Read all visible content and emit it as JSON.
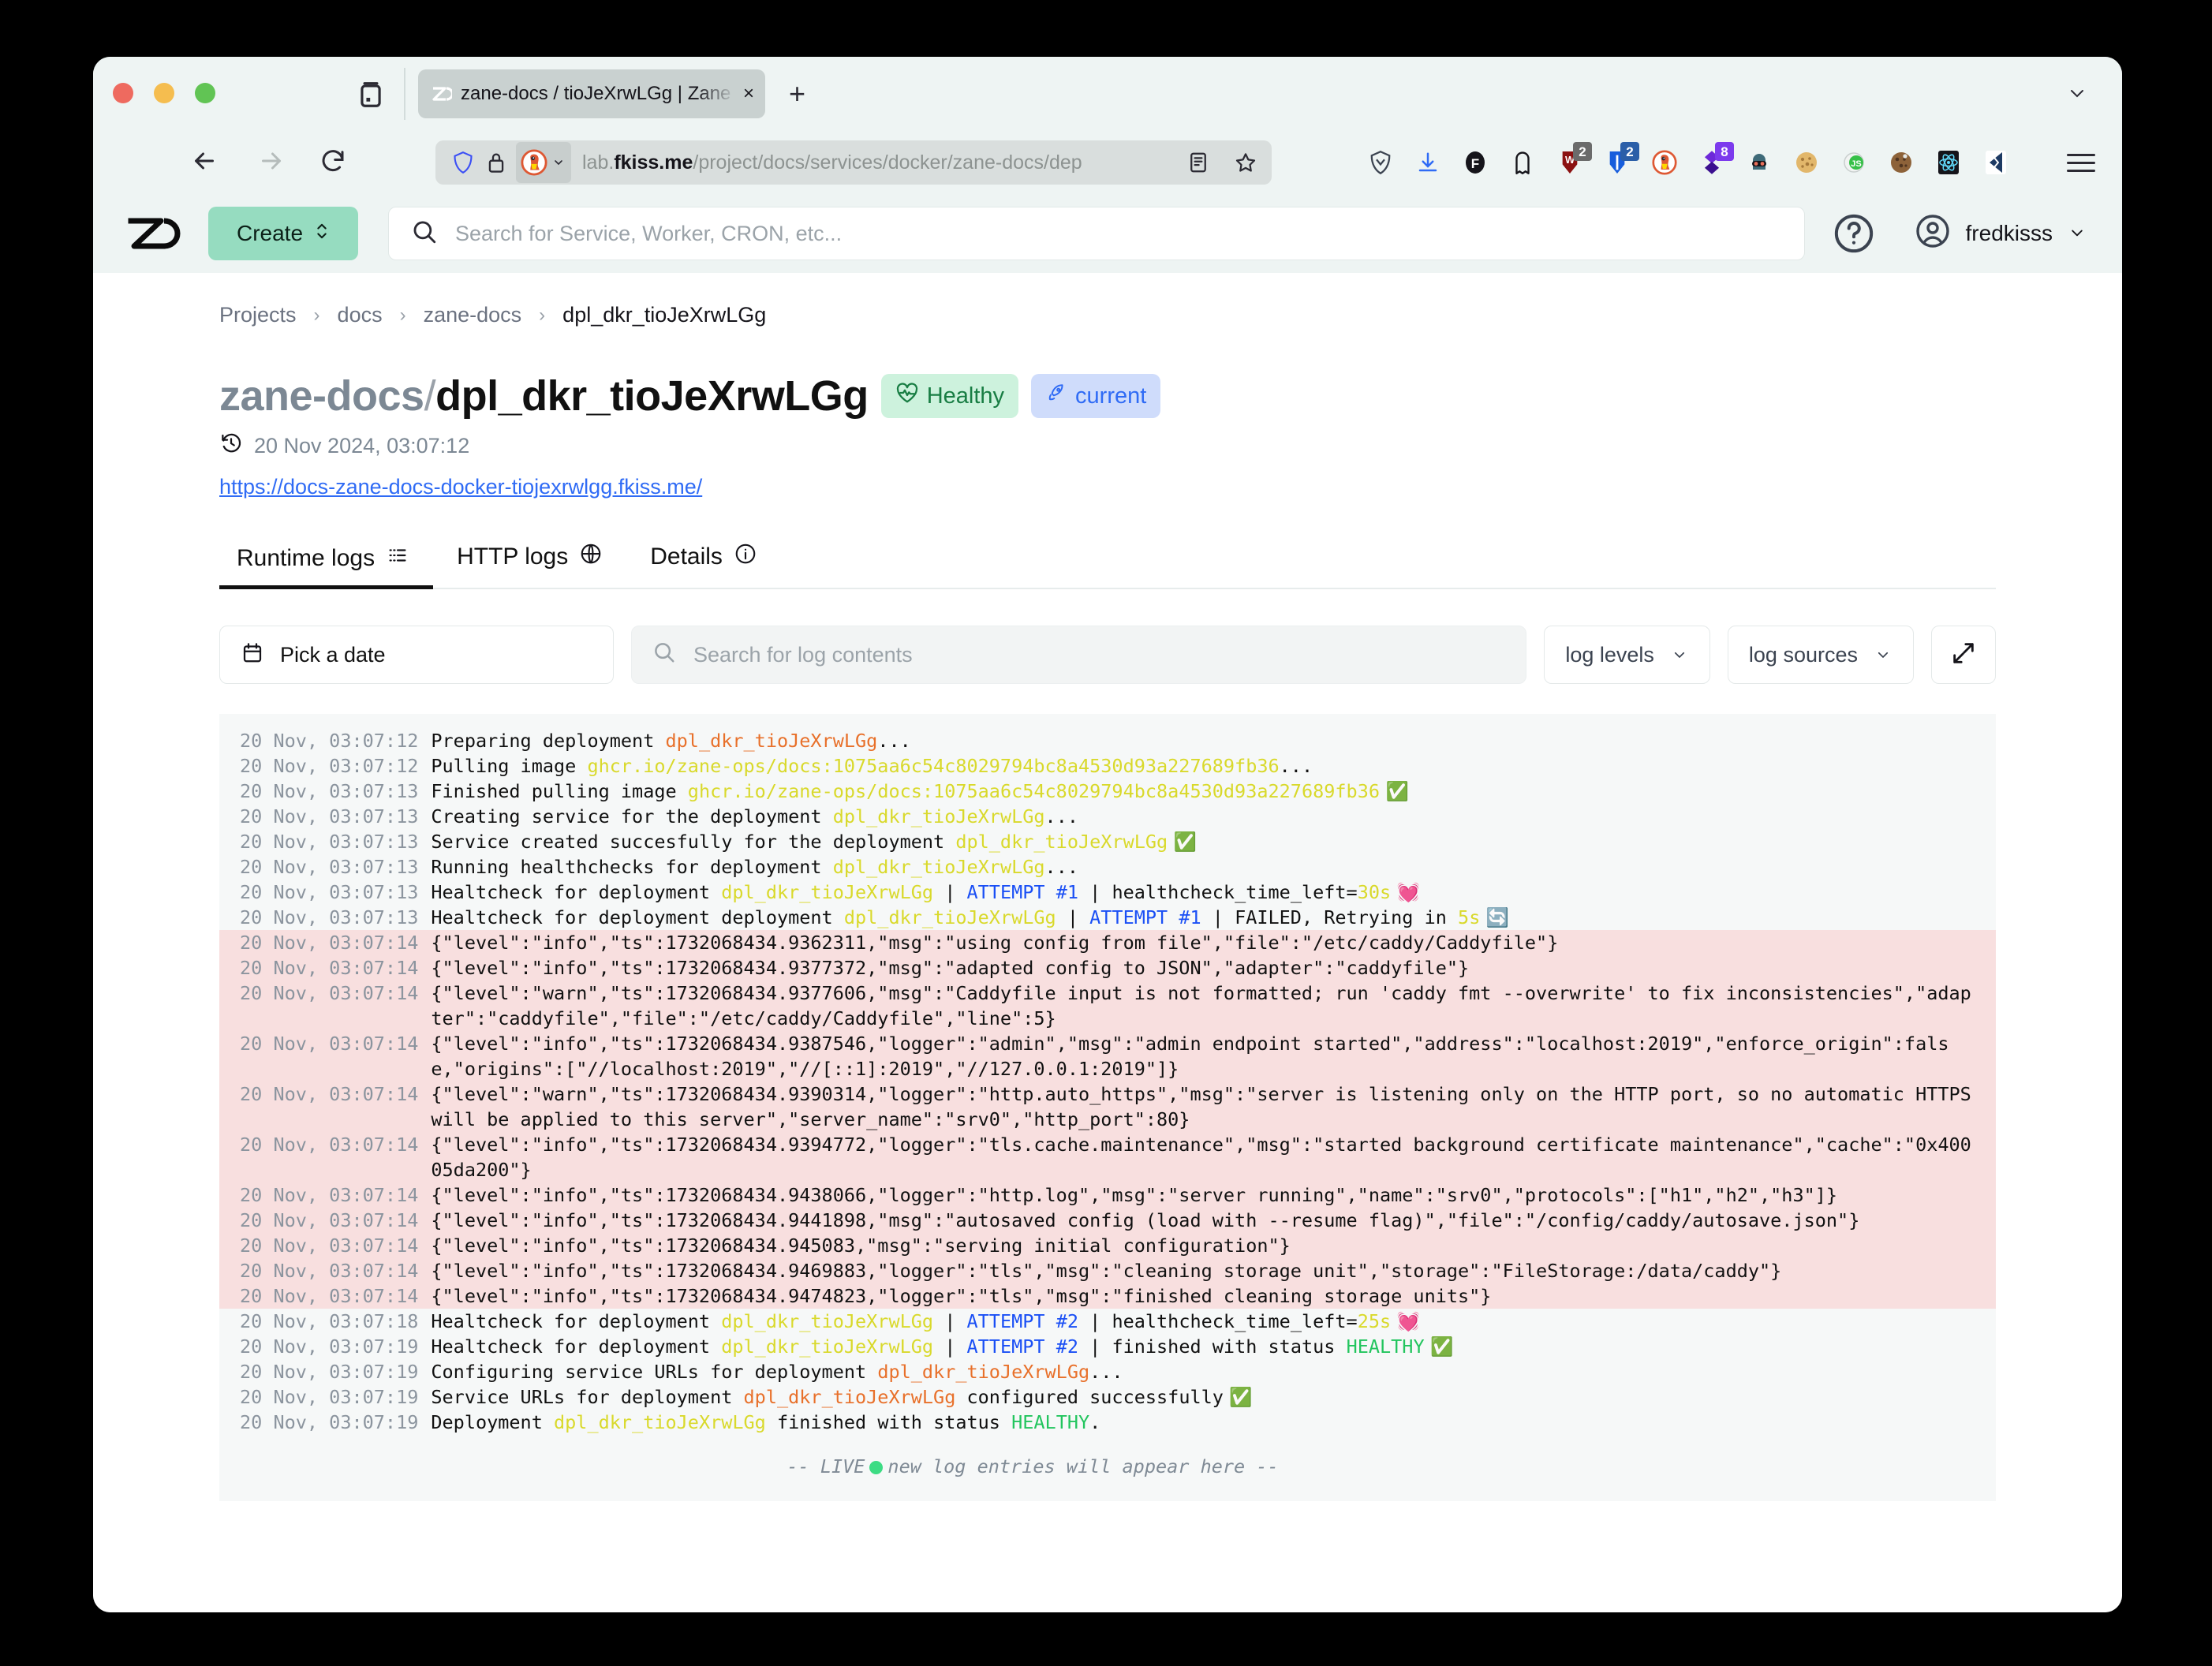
{
  "browser": {
    "tab": {
      "favicon": "zaneops-icon",
      "title": "zane-docs / tioJeXrwLGg | Zane",
      "close": "×"
    },
    "new_tab_label": "+",
    "url": {
      "host_dim_prefix": "lab.",
      "host_bold": "fkiss.me",
      "path": "/project/docs/services/docker/zane-docs/dep"
    },
    "extensions": [
      {
        "name": "nordvpn-icon",
        "badge": ""
      },
      {
        "name": "downloads-icon",
        "badge": ""
      },
      {
        "name": "facebook-container-icon",
        "badge": ""
      },
      {
        "name": "ghostery-icon",
        "badge": ""
      },
      {
        "name": "wappalyzer-icon",
        "badge": "2"
      },
      {
        "name": "bitwarden-icon",
        "badge": "2"
      },
      {
        "name": "duckduckgo-icon",
        "badge": ""
      },
      {
        "name": "react-devtools-purple-icon",
        "badge": "8"
      },
      {
        "name": "darkreader-icon",
        "badge": ""
      },
      {
        "name": "cookie-icon",
        "badge": ""
      },
      {
        "name": "json-viewer-icon",
        "badge": ""
      },
      {
        "name": "cookie-editor-icon",
        "badge": ""
      },
      {
        "name": "react-atom-icon",
        "badge": ""
      },
      {
        "name": "terminal-icon",
        "badge": ""
      }
    ]
  },
  "header": {
    "logo": "zaneops-logo",
    "create_label": "Create",
    "search_placeholder": "Search for Service, Worker, CRON, etc...",
    "search_value": "",
    "help_icon": "question-circle-icon",
    "user": "fredkisss"
  },
  "breadcrumb": [
    {
      "label": "Projects"
    },
    {
      "label": "docs"
    },
    {
      "label": "zane-docs"
    },
    {
      "label": "dpl_dkr_tioJeXrwLGg"
    }
  ],
  "breadcrumb_separator": "›",
  "page": {
    "service_name": "zane-docs",
    "separator": "/",
    "deployment_id": "dpl_dkr_tioJeXrwLGg",
    "status_badge": "Healthy",
    "current_badge": "current",
    "timestamp": "20 Nov 2024, 03:07:12",
    "deployment_url": "https://docs-zane-docs-docker-tiojexrwlgg.fkiss.me/"
  },
  "tabs": [
    {
      "label": "Runtime logs",
      "icon": "list-icon",
      "active": true
    },
    {
      "label": "HTTP logs",
      "icon": "globe-icon",
      "active": false
    },
    {
      "label": "Details",
      "icon": "info-circle-icon",
      "active": false
    }
  ],
  "toolbar": {
    "pick_date_label": "Pick a date",
    "pick_date_icon": "calendar-icon",
    "search_placeholder": "Search for log contents",
    "search_value": "",
    "log_levels_label": "log levels",
    "log_sources_label": "log sources",
    "expand_icon": "expand-icon"
  },
  "logs": {
    "live_prefix": "--",
    "live_label": "LIVE",
    "live_text": "new log entries will appear here",
    "live_suffix": "--",
    "lines": [
      {
        "ts": "20 Nov, 03:07:12",
        "err": false,
        "parts": [
          {
            "t": "Preparing deployment ",
            "c": ""
          },
          {
            "t": "dpl_dkr_tioJeXrwLGg",
            "c": "c-orange"
          },
          {
            "t": "...",
            "c": ""
          }
        ]
      },
      {
        "ts": "20 Nov, 03:07:12",
        "err": false,
        "parts": [
          {
            "t": "Pulling image ",
            "c": ""
          },
          {
            "t": "ghcr.io/zane-ops/docs:1075aa6c54c8029794bc8a4530d93a227689fb36",
            "c": "c-yellow"
          },
          {
            "t": "...",
            "c": ""
          }
        ]
      },
      {
        "ts": "20 Nov, 03:07:13",
        "err": false,
        "parts": [
          {
            "t": "Finished pulling image ",
            "c": ""
          },
          {
            "t": "ghcr.io/zane-ops/docs:1075aa6c54c8029794bc8a4530d93a227689fb36",
            "c": "c-yellow"
          },
          {
            "t": " ✅",
            "c": "emoji"
          }
        ]
      },
      {
        "ts": "20 Nov, 03:07:13",
        "err": false,
        "parts": [
          {
            "t": "Creating service for the deployment ",
            "c": ""
          },
          {
            "t": "dpl_dkr_tioJeXrwLGg",
            "c": "c-yellow"
          },
          {
            "t": "...",
            "c": ""
          }
        ]
      },
      {
        "ts": "20 Nov, 03:07:13",
        "err": false,
        "parts": [
          {
            "t": "Service created succesfully for the deployment ",
            "c": ""
          },
          {
            "t": "dpl_dkr_tioJeXrwLGg",
            "c": "c-yellow"
          },
          {
            "t": " ✅",
            "c": "emoji"
          }
        ]
      },
      {
        "ts": "20 Nov, 03:07:13",
        "err": false,
        "parts": [
          {
            "t": "Running healthchecks for deployment ",
            "c": ""
          },
          {
            "t": "dpl_dkr_tioJeXrwLGg",
            "c": "c-yellow"
          },
          {
            "t": "...",
            "c": ""
          }
        ]
      },
      {
        "ts": "20 Nov, 03:07:13",
        "err": false,
        "parts": [
          {
            "t": "Healtcheck for deployment ",
            "c": ""
          },
          {
            "t": "dpl_dkr_tioJeXrwLGg",
            "c": "c-yellow"
          },
          {
            "t": " | ",
            "c": ""
          },
          {
            "t": "ATTEMPT #1",
            "c": "c-blue"
          },
          {
            "t": " | healthcheck_time_left=",
            "c": ""
          },
          {
            "t": "30s",
            "c": "c-yellow"
          },
          {
            "t": " 💓",
            "c": "emoji"
          }
        ]
      },
      {
        "ts": "20 Nov, 03:07:13",
        "err": false,
        "parts": [
          {
            "t": "Healtcheck for deployment deployment ",
            "c": ""
          },
          {
            "t": "dpl_dkr_tioJeXrwLGg",
            "c": "c-yellow"
          },
          {
            "t": " | ",
            "c": ""
          },
          {
            "t": "ATTEMPT #1",
            "c": "c-blue"
          },
          {
            "t": " | FAILED, Retrying in ",
            "c": ""
          },
          {
            "t": "5s",
            "c": "c-yellow"
          },
          {
            "t": " 🔄",
            "c": "emoji"
          }
        ]
      },
      {
        "ts": "20 Nov, 03:07:14",
        "err": true,
        "parts": [
          {
            "t": "{\"level\":\"info\",\"ts\":1732068434.9362311,\"msg\":\"using config from file\",\"file\":\"/etc/caddy/Caddyfile\"}",
            "c": ""
          }
        ]
      },
      {
        "ts": "20 Nov, 03:07:14",
        "err": true,
        "parts": [
          {
            "t": "{\"level\":\"info\",\"ts\":1732068434.9377372,\"msg\":\"adapted config to JSON\",\"adapter\":\"caddyfile\"}",
            "c": ""
          }
        ]
      },
      {
        "ts": "20 Nov, 03:07:14",
        "err": true,
        "parts": [
          {
            "t": "{\"level\":\"warn\",\"ts\":1732068434.9377606,\"msg\":\"Caddyfile input is not formatted; run 'caddy fmt --overwrite' to fix inconsistencies\",\"adapter\":\"caddyfile\",\"file\":\"/etc/caddy/Caddyfile\",\"line\":5}",
            "c": ""
          }
        ]
      },
      {
        "ts": "20 Nov, 03:07:14",
        "err": true,
        "parts": [
          {
            "t": "{\"level\":\"info\",\"ts\":1732068434.9387546,\"logger\":\"admin\",\"msg\":\"admin endpoint started\",\"address\":\"localhost:2019\",\"enforce_origin\":false,\"origins\":[\"//localhost:2019\",\"//[::1]:2019\",\"//127.0.0.1:2019\"]}",
            "c": ""
          }
        ]
      },
      {
        "ts": "20 Nov, 03:07:14",
        "err": true,
        "parts": [
          {
            "t": "{\"level\":\"warn\",\"ts\":1732068434.9390314,\"logger\":\"http.auto_https\",\"msg\":\"server is listening only on the HTTP port, so no automatic HTTPS will be applied to this server\",\"server_name\":\"srv0\",\"http_port\":80}",
            "c": ""
          }
        ]
      },
      {
        "ts": "20 Nov, 03:07:14",
        "err": true,
        "parts": [
          {
            "t": "{\"level\":\"info\",\"ts\":1732068434.9394772,\"logger\":\"tls.cache.maintenance\",\"msg\":\"started background certificate maintenance\",\"cache\":\"0x40005da200\"}",
            "c": ""
          }
        ]
      },
      {
        "ts": "20 Nov, 03:07:14",
        "err": true,
        "parts": [
          {
            "t": "{\"level\":\"info\",\"ts\":1732068434.9438066,\"logger\":\"http.log\",\"msg\":\"server running\",\"name\":\"srv0\",\"protocols\":[\"h1\",\"h2\",\"h3\"]}",
            "c": ""
          }
        ]
      },
      {
        "ts": "20 Nov, 03:07:14",
        "err": true,
        "parts": [
          {
            "t": "{\"level\":\"info\",\"ts\":1732068434.9441898,\"msg\":\"autosaved config (load with --resume flag)\",\"file\":\"/config/caddy/autosave.json\"}",
            "c": ""
          }
        ]
      },
      {
        "ts": "20 Nov, 03:07:14",
        "err": true,
        "parts": [
          {
            "t": "{\"level\":\"info\",\"ts\":1732068434.945083,\"msg\":\"serving initial configuration\"}",
            "c": ""
          }
        ]
      },
      {
        "ts": "20 Nov, 03:07:14",
        "err": true,
        "parts": [
          {
            "t": "{\"level\":\"info\",\"ts\":1732068434.9469883,\"logger\":\"tls\",\"msg\":\"cleaning storage unit\",\"storage\":\"FileStorage:/data/caddy\"}",
            "c": ""
          }
        ]
      },
      {
        "ts": "20 Nov, 03:07:14",
        "err": true,
        "parts": [
          {
            "t": "{\"level\":\"info\",\"ts\":1732068434.9474823,\"logger\":\"tls\",\"msg\":\"finished cleaning storage units\"}",
            "c": ""
          }
        ]
      },
      {
        "ts": "20 Nov, 03:07:18",
        "err": false,
        "parts": [
          {
            "t": "Healtcheck for deployment ",
            "c": ""
          },
          {
            "t": "dpl_dkr_tioJeXrwLGg",
            "c": "c-yellow"
          },
          {
            "t": " | ",
            "c": ""
          },
          {
            "t": "ATTEMPT #2",
            "c": "c-blue"
          },
          {
            "t": " | healthcheck_time_left=",
            "c": ""
          },
          {
            "t": "25s",
            "c": "c-yellow"
          },
          {
            "t": " 💓",
            "c": "emoji"
          }
        ]
      },
      {
        "ts": "20 Nov, 03:07:19",
        "err": false,
        "parts": [
          {
            "t": "Healtcheck for deployment ",
            "c": ""
          },
          {
            "t": "dpl_dkr_tioJeXrwLGg",
            "c": "c-yellow"
          },
          {
            "t": " | ",
            "c": ""
          },
          {
            "t": "ATTEMPT #2",
            "c": "c-blue"
          },
          {
            "t": " | finished with status ",
            "c": ""
          },
          {
            "t": "HEALTHY",
            "c": "c-green"
          },
          {
            "t": " ✅",
            "c": "emoji"
          }
        ]
      },
      {
        "ts": "20 Nov, 03:07:19",
        "err": false,
        "parts": [
          {
            "t": "Configuring service URLs for deployment ",
            "c": ""
          },
          {
            "t": "dpl_dkr_tioJeXrwLGg",
            "c": "c-orange"
          },
          {
            "t": "...",
            "c": ""
          }
        ]
      },
      {
        "ts": "20 Nov, 03:07:19",
        "err": false,
        "parts": [
          {
            "t": "Service URLs for deployment ",
            "c": ""
          },
          {
            "t": "dpl_dkr_tioJeXrwLGg",
            "c": "c-orange"
          },
          {
            "t": " configured successfully",
            "c": ""
          },
          {
            "t": " ✅",
            "c": "emoji"
          }
        ]
      },
      {
        "ts": "20 Nov, 03:07:19",
        "err": false,
        "parts": [
          {
            "t": "Deployment ",
            "c": ""
          },
          {
            "t": "dpl_dkr_tioJeXrwLGg",
            "c": "c-yellow"
          },
          {
            "t": " finished with status ",
            "c": ""
          },
          {
            "t": "HEALTHY",
            "c": "c-green"
          },
          {
            "t": ".",
            "c": ""
          }
        ]
      }
    ]
  }
}
